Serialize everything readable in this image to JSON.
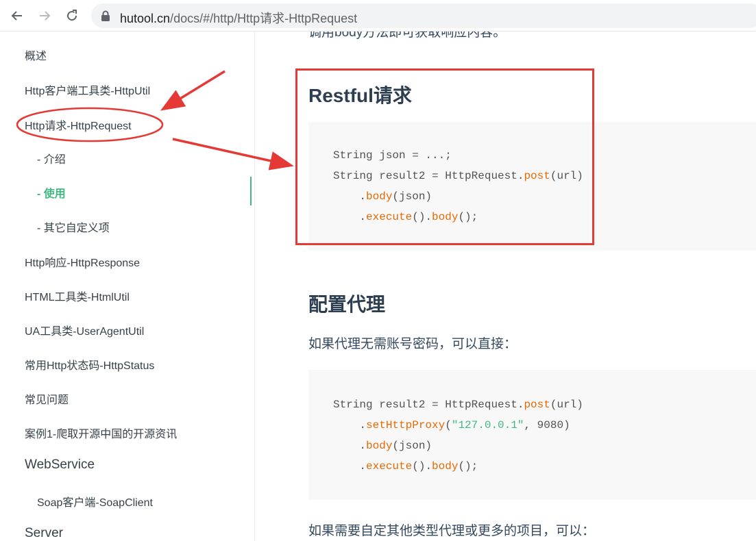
{
  "browser": {
    "back_icon": "arrow-left-icon",
    "forward_icon": "arrow-right-icon",
    "reload_icon": "reload-icon",
    "lock_icon": "lock-icon",
    "url_host": "hutool.cn",
    "url_path": "/docs/#/http/Http请求-HttpRequest"
  },
  "sidebar": {
    "items": [
      {
        "label": "概述"
      },
      {
        "label": "Http客户端工具类-HttpUtil"
      },
      {
        "label": "Http请求-HttpRequest"
      },
      {
        "label": "- 介绍"
      },
      {
        "label": "- 使用"
      },
      {
        "label": "- 其它自定义项"
      },
      {
        "label": "Http响应-HttpResponse"
      },
      {
        "label": "HTML工具类-HtmlUtil"
      },
      {
        "label": "UA工具类-UserAgentUtil"
      },
      {
        "label": "常用Http状态码-HttpStatus"
      },
      {
        "label": "常见问题"
      },
      {
        "label": "案例1-爬取开源中国的开源资讯"
      },
      {
        "label": "WebService"
      },
      {
        "label": "Soap客户端-SoapClient"
      },
      {
        "label": "Server"
      }
    ],
    "active_color": "#42b983"
  },
  "content": {
    "top_cut_text": "调用body方法即可获取响应内容。",
    "section1": {
      "title": "Restful请求",
      "code": [
        [
          "String json = ...;"
        ],
        [
          "String result2 = HttpRequest.",
          "post",
          "(url)"
        ],
        [
          "    .",
          "body",
          "(json)"
        ],
        [
          "    .",
          "execute",
          "().",
          "body",
          "();"
        ]
      ]
    },
    "section2": {
      "title": "配置代理",
      "para": "如果代理无需账号密码，可以直接：",
      "code": [
        [
          "String result2 = HttpRequest.",
          "post",
          "(url)"
        ],
        [
          "    .",
          "setHttpProxy",
          "(",
          "\"127.0.0.1\"",
          ", 9080)"
        ],
        [
          "    .",
          "body",
          "(json)"
        ],
        [
          "    .",
          "execute",
          "().",
          "body",
          "();"
        ]
      ],
      "para2": "如果需要自定其他类型代理或更多的项目，可以："
    }
  },
  "annotation": {
    "color": "#e53935"
  }
}
